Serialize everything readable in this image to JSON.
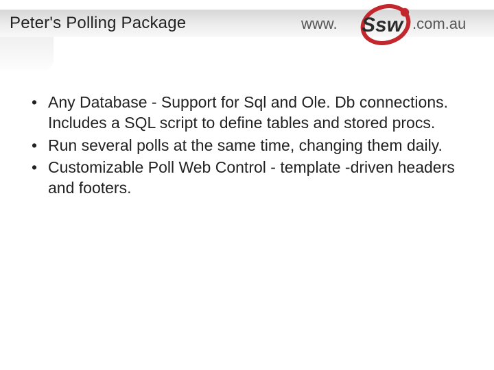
{
  "title": "Peter's Polling Package",
  "logo": {
    "prefix": "www.",
    "brand": "Ssw",
    "suffix": ".com.au"
  },
  "bullets": [
    "Any Database - Support for Sql and Ole. Db connections. Includes a SQL script to define tables and stored procs.",
    "Run several polls at the same time, changing them daily.",
    "Customizable Poll Web Control  - template -driven headers and footers."
  ]
}
